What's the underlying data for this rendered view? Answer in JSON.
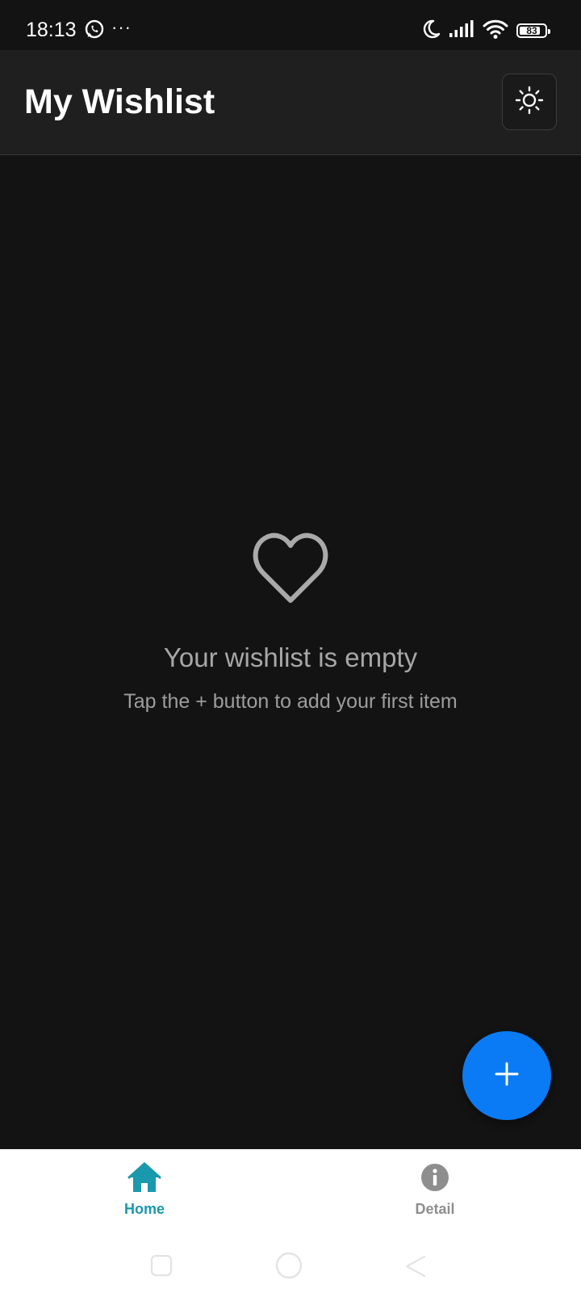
{
  "status_bar": {
    "time": "18:13",
    "left_icons": [
      "whatsapp-icon",
      "more-dots-icon"
    ],
    "dots": "···",
    "right_icons": [
      "moon-icon",
      "signal-icon",
      "wifi-icon",
      "battery-icon"
    ],
    "battery_level": "83",
    "battery_fraction": 0.83
  },
  "app_bar": {
    "title": "My Wishlist",
    "theme_toggle_icon": "sun-icon"
  },
  "empty_state": {
    "icon": "heart-outline-icon",
    "title": "Your wishlist is empty",
    "subtitle": "Tap the + button to add your first item"
  },
  "fab": {
    "icon": "plus-icon",
    "color": "#0a7bf4"
  },
  "bottom_nav": {
    "items": [
      {
        "label": "Home",
        "icon": "home-icon",
        "active": true,
        "color": "#1a98ad"
      },
      {
        "label": "Detail",
        "icon": "info-icon",
        "active": false,
        "color": "#8e8e8e"
      }
    ]
  },
  "system_nav": {
    "buttons": [
      "recent-apps-icon",
      "home-circle-icon",
      "back-icon"
    ]
  },
  "colors": {
    "background": "#131313",
    "app_bar": "#1f1f1f",
    "accent_blue": "#0a7bf4",
    "accent_teal": "#1a98ad",
    "muted_text": "#a7a7a7"
  }
}
